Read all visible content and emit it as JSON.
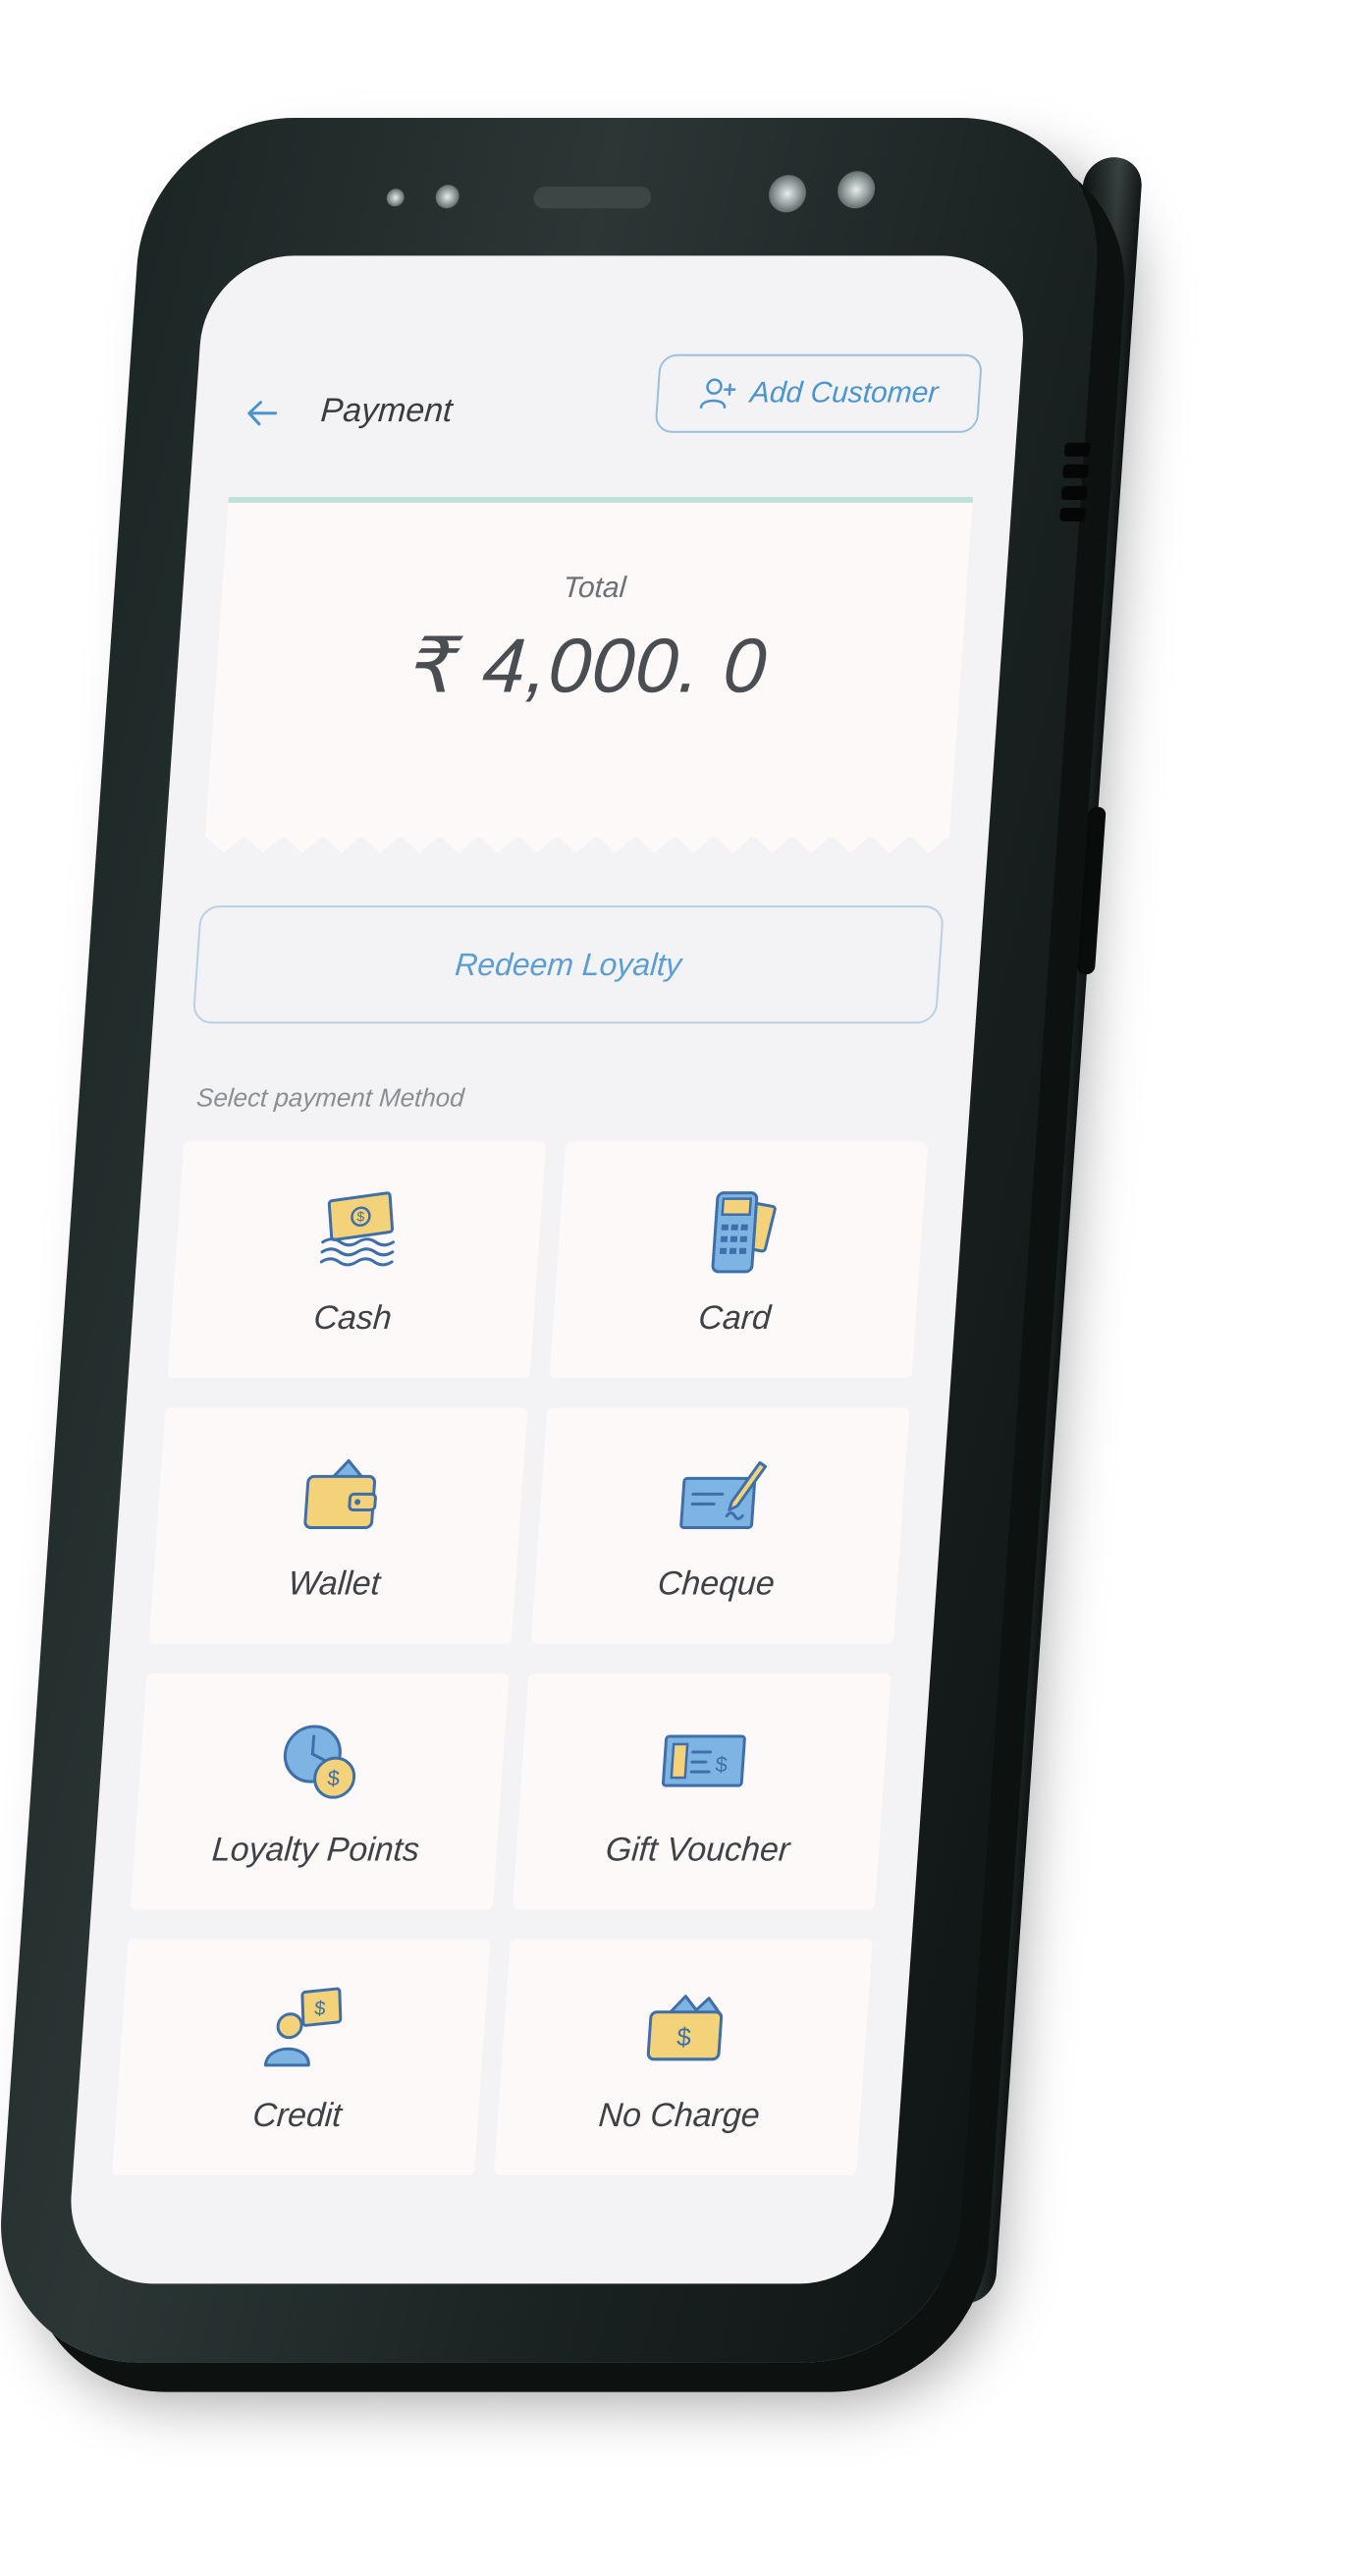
{
  "header": {
    "title": "Payment",
    "add_customer_label": "Add Customer"
  },
  "total": {
    "label": "Total",
    "amount": "₹ 4,000. 0"
  },
  "redeem_label": "Redeem Loyalty",
  "section_label": "Select payment Method",
  "methods": [
    {
      "label": "Cash",
      "icon": "cash-icon"
    },
    {
      "label": "Card",
      "icon": "card-terminal-icon"
    },
    {
      "label": "Wallet",
      "icon": "wallet-icon"
    },
    {
      "label": "Cheque",
      "icon": "cheque-icon"
    },
    {
      "label": "Loyalty Points",
      "icon": "loyalty-points-icon"
    },
    {
      "label": "Gift Voucher",
      "icon": "gift-voucher-icon"
    },
    {
      "label": "Credit",
      "icon": "credit-icon"
    },
    {
      "label": "No Charge",
      "icon": "no-charge-icon"
    }
  ],
  "colors": {
    "accent": "#4b95cf",
    "icon_yellow": "#f3d27a",
    "icon_blue": "#7eb4e3",
    "screen_bg": "#f3f2f4",
    "card_bg": "#fcf9f8"
  }
}
